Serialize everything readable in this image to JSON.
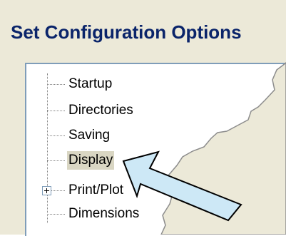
{
  "window": {
    "title": "Set Configuration Options"
  },
  "tree": {
    "items": [
      {
        "label": "Startup",
        "expandable": false,
        "selected": false
      },
      {
        "label": "Directories",
        "expandable": false,
        "selected": false
      },
      {
        "label": "Saving",
        "expandable": false,
        "selected": false
      },
      {
        "label": "Display",
        "expandable": false,
        "selected": true
      },
      {
        "label": "Print/Plot",
        "expandable": true,
        "selected": false
      },
      {
        "label": "Dimensions",
        "expandable": false,
        "selected": false
      }
    ]
  },
  "annotation": {
    "icon": "pointer-arrow-icon",
    "color": "#cde8f6"
  }
}
